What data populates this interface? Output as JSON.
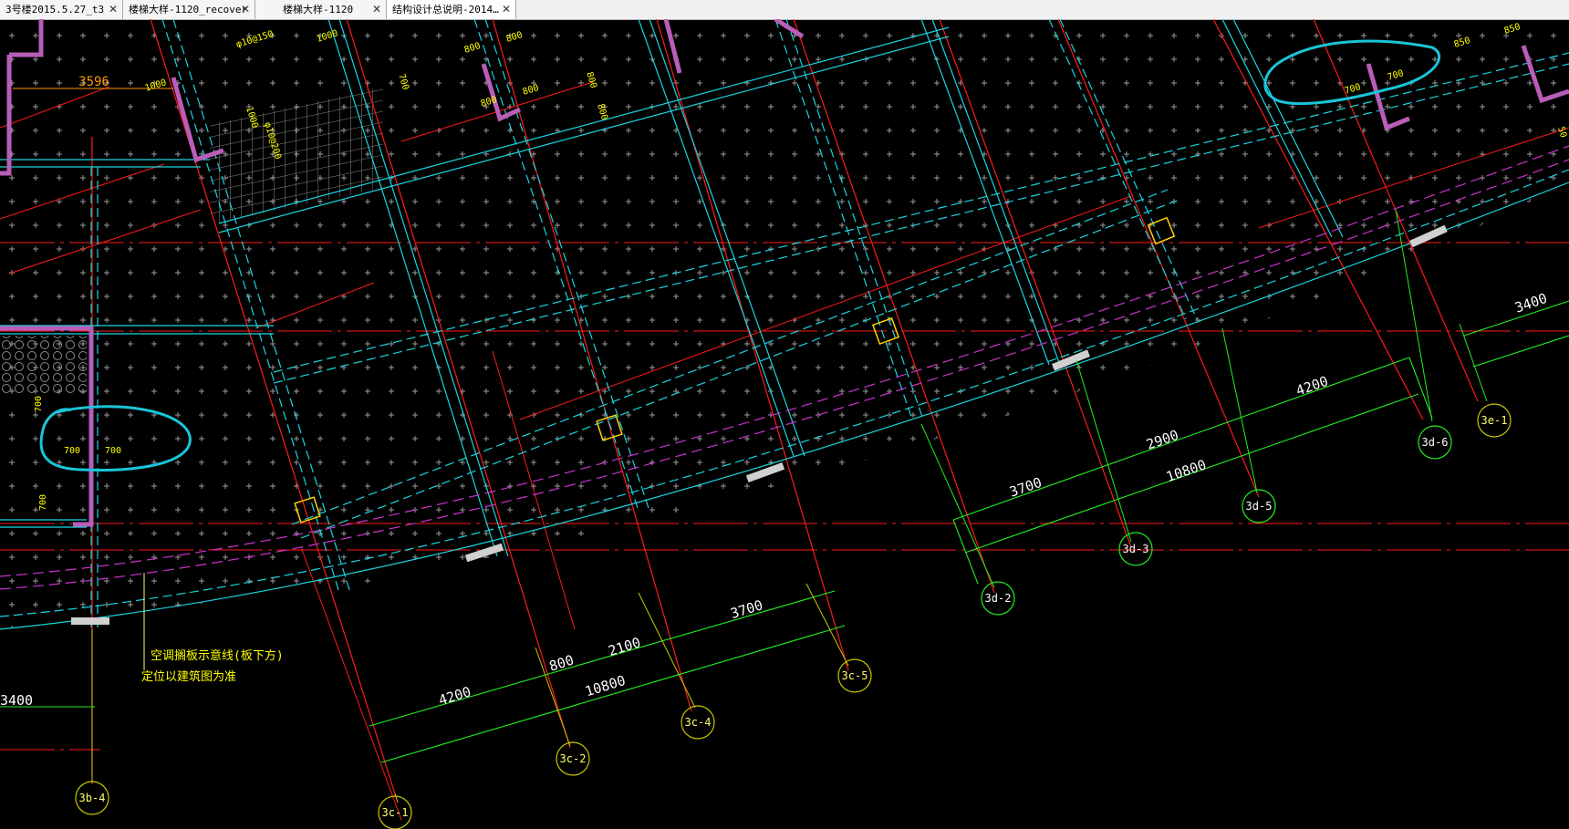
{
  "tabs": [
    {
      "label": "3号楼2015.5.27_t3",
      "close": "✕"
    },
    {
      "label": "楼梯大样-1120_recover",
      "close": "✕"
    },
    {
      "label": "楼梯大样-1120",
      "close": "✕"
    },
    {
      "label": "结构设计总说明-2014…",
      "close": "✕"
    }
  ],
  "drawing": {
    "colors": {
      "axis": "#ff1a1a",
      "wall": "#19d6e0",
      "dim": "#22ee22",
      "note": "#ffff00",
      "slab": "#cc33cc",
      "column": "#b85db8",
      "markup": "#19c5d8"
    },
    "axis_labels": {
      "c1": "3c-1",
      "c2": "3c-2",
      "c4": "3c-4",
      "c5": "3c-5",
      "d2": "3d-2",
      "d3": "3d-3",
      "d5": "3d-5",
      "d6": "3d-6",
      "e1": "3e-1",
      "b4": "3b-4"
    },
    "dimensions": {
      "c_4200": "4200",
      "c_800": "800",
      "c_2100": "2100",
      "c_3700": "3700",
      "c_10800": "10800",
      "d_3700": "3700",
      "d_2900": "2900",
      "d_4200": "4200",
      "d_10800": "10800",
      "e_3400": "3400",
      "left_3400": "3400",
      "top_3596": "3596"
    },
    "small_labels": {
      "rebar1": "φ10@150",
      "rebar2": "φ10@200",
      "m1000a": "1000",
      "m1000b": "1000",
      "m1000c": "1000",
      "m800a": "800",
      "m800b": "800",
      "m800c": "800",
      "m800d": "800",
      "m800e": "800",
      "m700a": "700",
      "m700b": "700",
      "m700c": "700",
      "m700d": "700",
      "m700e": "700",
      "m700f": "700",
      "m700g": "700",
      "m850a": "850",
      "m850b": "850",
      "m800f": "800",
      "m50": "50"
    },
    "note_line1": "空调搁板示意线(板下方)",
    "note_line2": "定位以建筑图为准"
  }
}
